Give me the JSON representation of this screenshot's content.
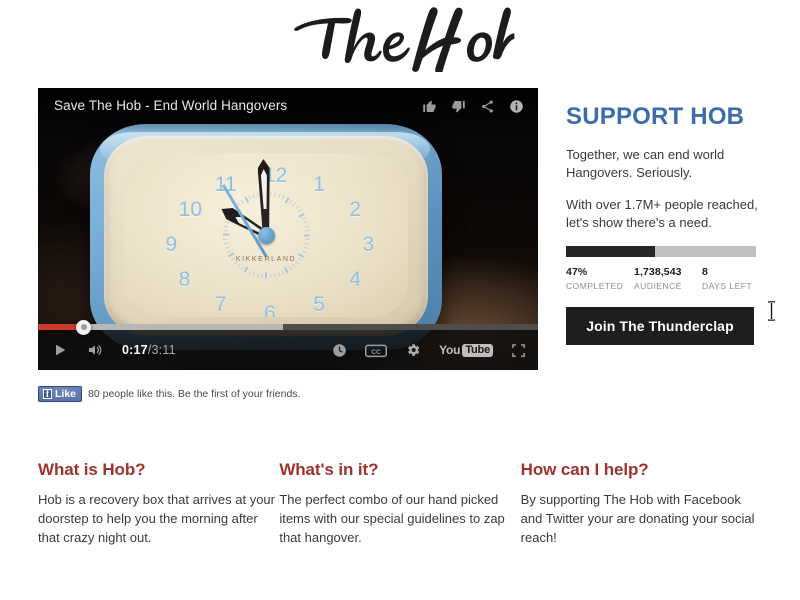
{
  "site": {
    "logo_text": "The Hob",
    "background_color": "#ffffff"
  },
  "video": {
    "title": "Save The Hob - End World Hangovers",
    "current_time": "0:17",
    "separator": "/",
    "total_time": "3:11",
    "played_percent": 9,
    "loaded_percent": 49,
    "top_icons": [
      {
        "name": "thumbs-up-icon",
        "label": "Like video"
      },
      {
        "name": "thumbs-down-icon",
        "label": "Dislike video"
      },
      {
        "name": "share-icon",
        "label": "Share"
      },
      {
        "name": "info-icon",
        "label": "Info"
      }
    ],
    "controls": {
      "play_label": "Play",
      "volume_label": "Volume",
      "watch_later_label": "Watch later",
      "captions_label": "CC",
      "settings_label": "Settings",
      "fullscreen_label": "Fullscreen",
      "youtube_word": "You",
      "youtube_box": "Tube"
    },
    "scene": {
      "brand_on_clock": "KIKKERLAND",
      "numerals": [
        "12",
        "1",
        "2",
        "3",
        "4",
        "5",
        "6",
        "7",
        "8",
        "9",
        "10",
        "11"
      ],
      "bezel_color": "#6da0ca",
      "face_color": "#ece2c9",
      "numeral_color": "#8fc0e2"
    }
  },
  "facebook": {
    "button_label": "Like",
    "f_glyph": "f",
    "social_text": "80 people like this. Be the first of your friends."
  },
  "sidebar": {
    "heading": "SUPPORT HOB",
    "heading_color": "#3d6cab",
    "paragraph_1": "Together, we can end world Hangovers. Seriously.",
    "paragraph_2": "With over 1.7M+ people reached, let's show there's a need.",
    "progress": {
      "percent": 47,
      "fill_color": "#262626",
      "track_color": "#bfbfbf"
    },
    "stats": [
      {
        "value": "47%",
        "label": "COMPLETED"
      },
      {
        "value": "1,738,543",
        "label": "AUDIENCE"
      },
      {
        "value": "8",
        "label": "DAYS LEFT"
      }
    ],
    "cta_label": "Join The Thunderclap",
    "cta_color": "#1e1e1e"
  },
  "columns": [
    {
      "heading": "What is Hob?",
      "body": "Hob is a recovery box that arrives at your doorstep to help you the morning after that crazy night out."
    },
    {
      "heading": "What's in it?",
      "body": "The perfect combo of our hand picked items with our special guidelines to zap that hangover."
    },
    {
      "heading": "How can I help?",
      "body": "By supporting The Hob with Facebook and Twitter your are donating your social reach!"
    }
  ],
  "columns_heading_color": "#9e3330"
}
